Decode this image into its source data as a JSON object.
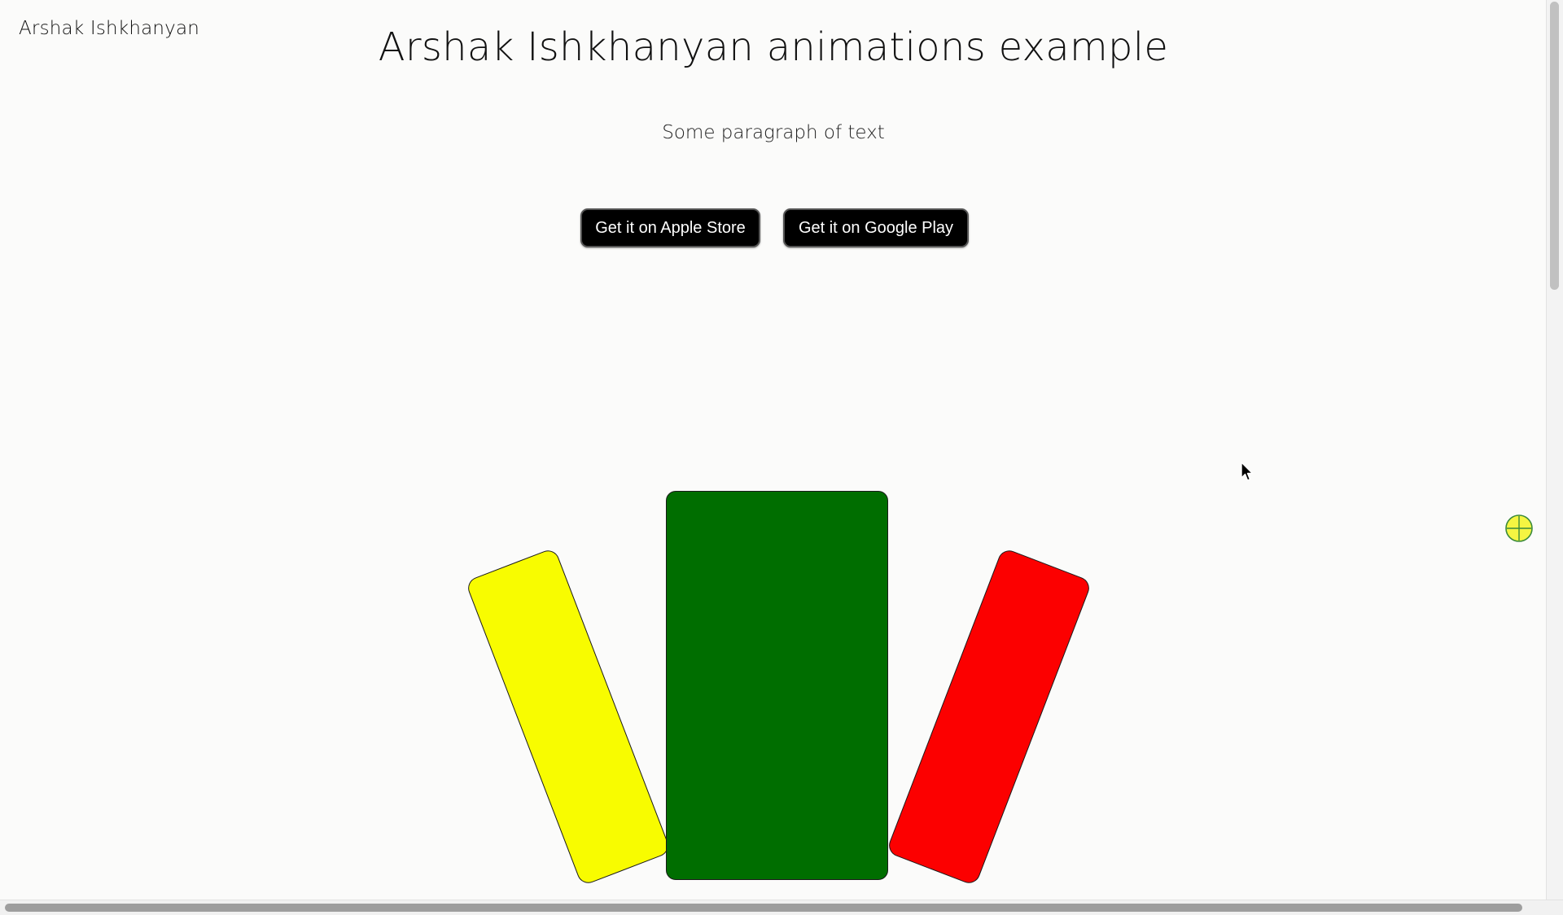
{
  "header": {
    "brand": "Arshak Ishkhanyan",
    "title": "Arshak Ishkhanyan animations example",
    "paragraph": "Some paragraph of text"
  },
  "buttons": {
    "apple_label": "Get it on Apple Store",
    "google_label": "Get it on Google Play"
  },
  "cards": {
    "left_color": "#f8fc00",
    "center_color": "#006e00",
    "right_color": "#fc0000"
  },
  "overlay": {
    "cursor_icon": "mouse-pointer-icon",
    "crosshair_icon": "yellow-crosshair-icon",
    "crosshair_color": "#f5f542"
  }
}
